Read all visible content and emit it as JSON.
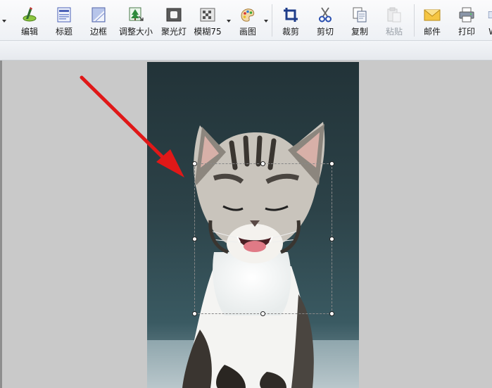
{
  "toolbar": {
    "items": [
      {
        "id": "edit",
        "label": "编辑",
        "icon": "edit-icon"
      },
      {
        "id": "title",
        "label": "标题",
        "icon": "title-icon"
      },
      {
        "id": "border",
        "label": "边框",
        "icon": "border-icon"
      },
      {
        "id": "resize",
        "label": "调整大小",
        "icon": "resize-icon"
      },
      {
        "id": "spotlight",
        "label": "聚光灯",
        "icon": "spotlight-icon"
      },
      {
        "id": "blur",
        "label": "模糊75",
        "icon": "blur-icon"
      },
      {
        "id": "draw",
        "label": "画图",
        "icon": "draw-icon"
      },
      {
        "id": "crop",
        "label": "裁剪",
        "icon": "crop-icon"
      },
      {
        "id": "cut",
        "label": "剪切",
        "icon": "scissors-icon"
      },
      {
        "id": "copy",
        "label": "复制",
        "icon": "copy-icon"
      },
      {
        "id": "paste",
        "label": "粘贴",
        "icon": "paste-icon",
        "disabled": true
      },
      {
        "id": "mail",
        "label": "邮件",
        "icon": "mail-icon"
      },
      {
        "id": "print",
        "label": "打印",
        "icon": "printer-icon"
      },
      {
        "id": "more",
        "label": "W",
        "icon": "more-icon"
      }
    ]
  },
  "colors": {
    "arrow": "#e01818",
    "photo_background": "#2c3f45",
    "canvas": "#c9c9c9"
  }
}
